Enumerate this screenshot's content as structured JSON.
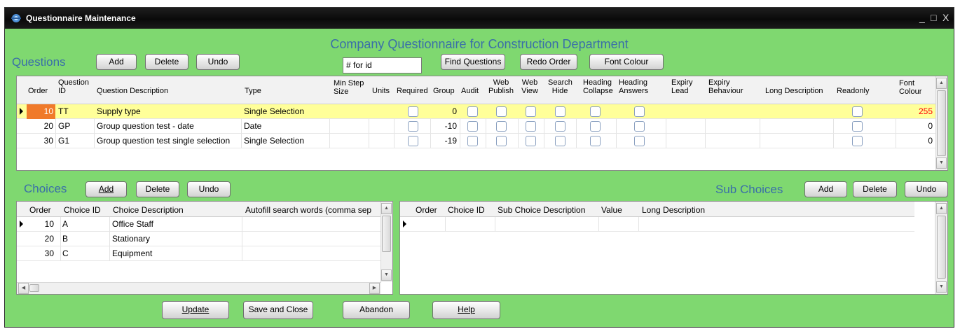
{
  "window": {
    "title": "Questionnaire Maintenance",
    "controls": [
      "_",
      "□",
      "X"
    ]
  },
  "main_title": "Company Questionnaire for Construction Department",
  "questions": {
    "label": "Questions",
    "add": "Add",
    "delete": "Delete",
    "undo": "Undo",
    "search_value": "# for id",
    "find": "Find Questions",
    "redo_order": "Redo Order",
    "font_colour": "Font Colour",
    "headers": [
      "Order",
      "Question ID",
      "Question Description",
      "Type",
      "Min Step Size",
      "Units",
      "Required",
      "Group",
      "Audit",
      "Web Publish",
      "Web View",
      "Search Hide",
      "Heading Collapse",
      "Heading Answers",
      "Expiry Lead",
      "Expiry Behaviour",
      "Long Description",
      "Readonly",
      "Font Colour"
    ],
    "rows": [
      {
        "order": "10",
        "id": "TT",
        "description": "Supply type",
        "type": "Single Selection",
        "group": "0",
        "font_colour": "255"
      },
      {
        "order": "20",
        "id": "GP",
        "description": "Group question test - date",
        "type": "Date",
        "group": "-10",
        "font_colour": "0"
      },
      {
        "order": "30",
        "id": "G1",
        "description": "Group question test single selection",
        "type": "Single Selection",
        "group": "-19",
        "font_colour": "0"
      }
    ]
  },
  "choices": {
    "label": "Choices",
    "add": "Add",
    "delete": "Delete",
    "undo": "Undo",
    "headers": [
      "Order",
      "Choice ID",
      "Choice Description",
      "Autofill search words (comma sep"
    ],
    "rows": [
      {
        "order": "10",
        "id": "A",
        "description": "Office Staff"
      },
      {
        "order": "20",
        "id": "B",
        "description": "Stationary"
      },
      {
        "order": "30",
        "id": "C",
        "description": "Equipment"
      }
    ]
  },
  "sub_choices": {
    "label": "Sub Choices",
    "add": "Add",
    "delete": "Delete",
    "undo": "Undo",
    "headers": [
      "Order",
      "Choice ID",
      "Sub Choice Description",
      "Value",
      "Long Description"
    ]
  },
  "footer": {
    "update": "Update",
    "save_close": "Save and Close",
    "abandon": "Abandon",
    "help": "Help"
  },
  "colors": {
    "background": "#7fd870",
    "highlight_row": "#ffff99",
    "font_colour_255": "#ff0000"
  }
}
